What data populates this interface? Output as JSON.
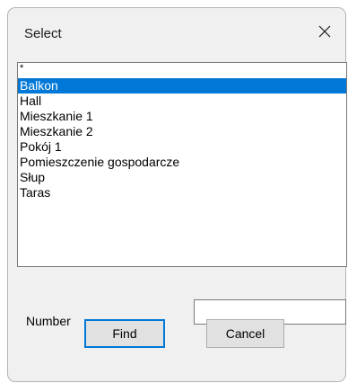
{
  "window": {
    "title": "Select",
    "close_icon": "close-icon"
  },
  "list": {
    "items": [
      "*",
      "Balkon",
      "Hall",
      "Mieszkanie 1",
      "Mieszkanie 2",
      "Pokój 1",
      "Pomieszczenie gospodarcze",
      "Słup",
      "Taras"
    ],
    "selected": "Balkon"
  },
  "number": {
    "label": "Number",
    "value": ""
  },
  "buttons": {
    "find_label": "Find",
    "cancel_label": "Cancel"
  },
  "colors": {
    "selection": "#0078d7",
    "default_button_border": "#0078d7"
  }
}
